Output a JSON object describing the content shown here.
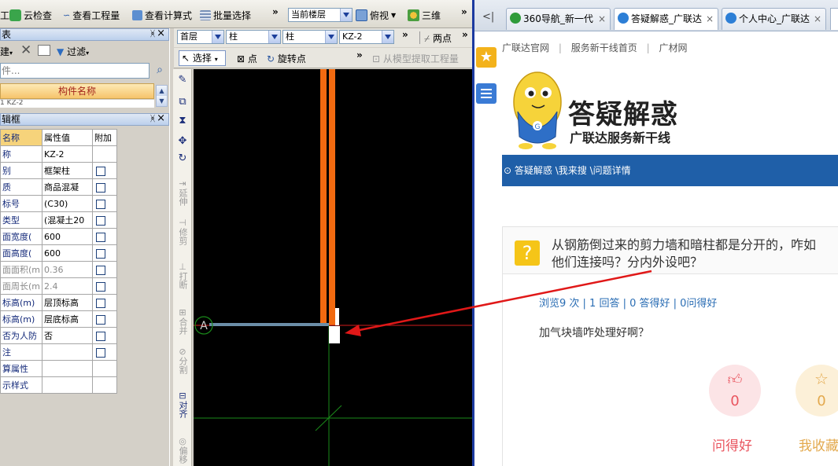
{
  "cad": {
    "toolbar1": {
      "item0": "工",
      "cloud_check": "云检查",
      "view_quantity": "查看工程量",
      "view_formula": "查看计算式",
      "batch_select": "批量选择",
      "floor_combo": "当前楼层",
      "view_top": "俯视",
      "view_3d": "三维"
    },
    "toolbar2": {
      "floor": "首层",
      "type1": "柱",
      "type2": "柱",
      "element": "KZ-2",
      "two_point": "两点"
    },
    "toolbar3": {
      "select": "选择",
      "point": "点",
      "rotate_point": "旋转点",
      "extract": "从模型提取工程量"
    },
    "list_panel": {
      "title": "表",
      "new": "建",
      "filter": "过滤",
      "search_placeholder": "件...",
      "column_header": "构件名称",
      "row_partial": "1 KZ-2"
    },
    "prop_panel": {
      "title": "辑框",
      "headers": [
        "名称",
        "属性值",
        "附加"
      ],
      "rows": [
        {
          "name": "称",
          "value": "KZ-2",
          "check": false,
          "gray": false
        },
        {
          "name": "别",
          "value": "框架柱",
          "check": true,
          "gray": false
        },
        {
          "name": "质",
          "value": "商品混凝",
          "check": true,
          "gray": false
        },
        {
          "name": "标号",
          "value": "(C30)",
          "check": true,
          "gray": false
        },
        {
          "name": "类型",
          "value": "(混凝土20",
          "check": true,
          "gray": false
        },
        {
          "name": "面宽度(",
          "value": "600",
          "check": true,
          "gray": false
        },
        {
          "name": "面高度(",
          "value": "600",
          "check": true,
          "gray": false
        },
        {
          "name": "面面积(m",
          "value": "0.36",
          "check": true,
          "gray": true
        },
        {
          "name": "面周长(m",
          "value": "2.4",
          "check": true,
          "gray": true
        },
        {
          "name": "标高(m)",
          "value": "层顶标高",
          "check": true,
          "gray": false
        },
        {
          "name": "标高(m)",
          "value": "层底标高",
          "check": true,
          "gray": false
        },
        {
          "name": "否为人防",
          "value": "否",
          "check": true,
          "gray": false
        },
        {
          "name": "注",
          "value": "",
          "check": true,
          "gray": false
        },
        {
          "name": "算属性",
          "value": "",
          "check": false,
          "gray": false
        },
        {
          "name": "示样式",
          "value": "",
          "check": false,
          "gray": false
        }
      ]
    },
    "vtools": {
      "extend": "延伸",
      "trim": "修剪",
      "break": "打断",
      "merge": "合并",
      "split": "分割",
      "align": "对齐",
      "offset": "偏移"
    },
    "canvas": {
      "axis_label": "A"
    }
  },
  "browser": {
    "tabs": [
      {
        "label": "360导航_新一代"
      },
      {
        "label": "答疑解惑_广联达"
      },
      {
        "label": "个人中心_广联达"
      }
    ],
    "topnav": [
      "广联达官网",
      "服务新干线首页",
      "广材网"
    ],
    "logo": {
      "title": "答疑解惑",
      "subtitle": "广联达服务新干线"
    },
    "breadcrumb": "答疑解惑 \\我来搜 \\问题详情",
    "question": {
      "line1": "从钢筋倒过来的剪力墙和暗柱都是分开的，咋如",
      "line2": "他们连接吗？分内外设吧？",
      "icon": "?"
    },
    "stats": "浏览9 次 | 1 回答 | 0 答得好 | 0问得好",
    "answer": "加气块墙咋处理好啊？",
    "actions": [
      {
        "count": "0",
        "label": "问得好"
      },
      {
        "count": "0",
        "label": "我收藏"
      }
    ],
    "colors": {
      "brand_blue": "#1f5fa8",
      "pink": "#e9555f",
      "gold": "#e3a94e"
    }
  }
}
